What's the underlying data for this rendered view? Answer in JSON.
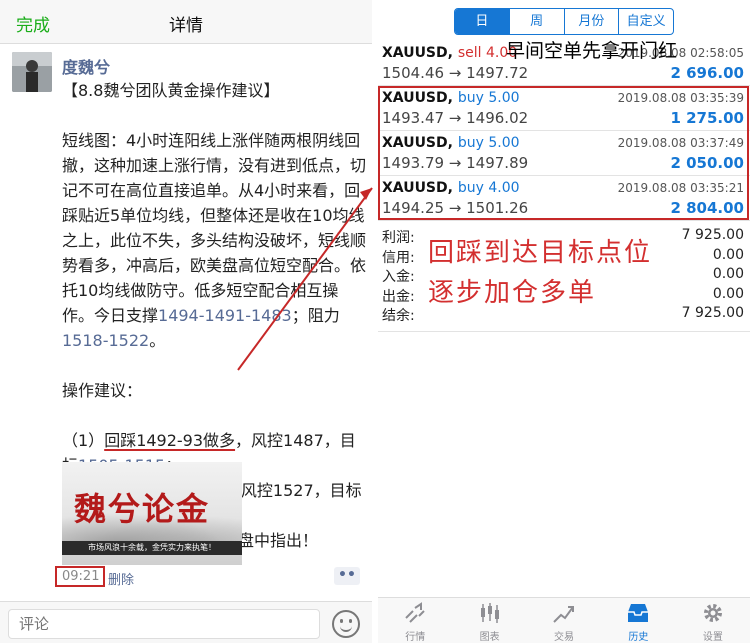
{
  "left": {
    "done_label": "完成",
    "title": "详情",
    "author": "度魏兮",
    "post_lines": [
      "【8.8魏兮团队黄金操作建议】",
      "",
      "短线图：4小时连阳线上涨伴随两根阴线回撤，这种加速上涨行情，没有进到低点，切记不可在高位直接追单。从4小时来看，回踩贴近5单位均线，但整体还是收在10均线之上，此位不失，多头结构没破坏，短线顺势看多，冲高后，欧美盘高位短空配合。依托10均线做防守。低多短空配合相互操作。今日支撑",
      "1494-1491-1483",
      "；阻力",
      "1518-1522",
      "。",
      "操作建议："
    ],
    "op1_prefix": "（1）",
    "op1_underlined": "回踩1492-93做多",
    "op1_rest": "，风控1487，目标",
    "op1_target": "1505-1515",
    "op1_end": "；",
    "op2": "（2）冲高见1522短空，风控1527，目标1512-1508.",
    "op3": "具体变盘调整魏兮会在实盘中指出！",
    "promo_title": "魏兮论金",
    "promo_band": "市场风浪十余载，金凭实力来执笔！",
    "time": "09:21",
    "delete_label": "删除",
    "more_label": "••",
    "comment_placeholder": "评论"
  },
  "right": {
    "segments": [
      {
        "label": "日",
        "active": true
      },
      {
        "label": "周",
        "active": false
      },
      {
        "label": "月份",
        "active": false
      },
      {
        "label": "自定义",
        "active": false
      }
    ],
    "head_note": "早间空单先拿开门红",
    "trades": [
      {
        "symbol": "XAUUSD,",
        "side": "sell",
        "lots": "4.00",
        "datetime": "2019.08.08 02:58:05",
        "prices": "1504.46 → 1497.72",
        "profit": "2 696.00"
      },
      {
        "symbol": "XAUUSD,",
        "side": "buy",
        "lots": "5.00",
        "datetime": "2019.08.08 03:35:39",
        "prices": "1493.47 → 1496.02",
        "profit": "1 275.00"
      },
      {
        "symbol": "XAUUSD,",
        "side": "buy",
        "lots": "5.00",
        "datetime": "2019.08.08 03:37:49",
        "prices": "1493.79 → 1497.89",
        "profit": "2 050.00"
      },
      {
        "symbol": "XAUUSD,",
        "side": "buy",
        "lots": "4.00",
        "datetime": "2019.08.08 03:35:21",
        "prices": "1494.25 → 1501.26",
        "profit": "2 804.00"
      }
    ],
    "summary": [
      {
        "label": "利润:",
        "value": "7 925.00"
      },
      {
        "label": "信用:",
        "value": "0.00"
      },
      {
        "label": "入金:",
        "value": "0.00"
      },
      {
        "label": "出金:",
        "value": "0.00"
      },
      {
        "label": "结余:",
        "value": "7 925.00"
      }
    ],
    "annotation_line1": "回踩到达目标点位",
    "annotation_line2": "逐步加仓多单",
    "tabs": [
      {
        "label": "行情",
        "icon": "quotes-icon",
        "active": false
      },
      {
        "label": "图表",
        "icon": "chart-icon",
        "active": false
      },
      {
        "label": "交易",
        "icon": "trade-icon",
        "active": false
      },
      {
        "label": "历史",
        "icon": "history-icon",
        "active": true
      },
      {
        "label": "设置",
        "icon": "settings-icon",
        "active": false
      }
    ]
  },
  "colors": {
    "wechat_green": "#1aad19",
    "link_blue": "#576b95",
    "accent_blue": "#1677d4",
    "sell_red": "#d32f2f",
    "annotation_red": "#c62828"
  }
}
